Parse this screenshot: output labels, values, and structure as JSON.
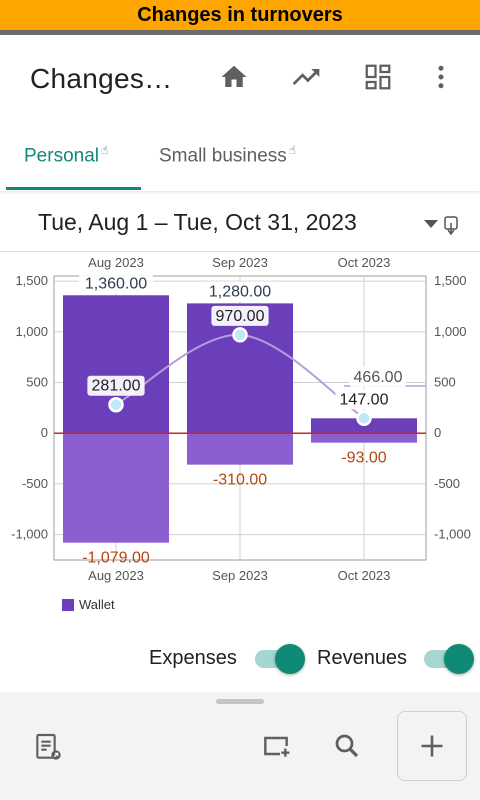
{
  "banner": {
    "title": "Changes in turnovers"
  },
  "appbar": {
    "title": "Changes…",
    "icons": [
      "home-icon",
      "trending-up-icon",
      "dashboard-grid-icon",
      "more-vert-icon"
    ]
  },
  "tabs": [
    {
      "label": "Personal",
      "selected": true
    },
    {
      "label": "Small business",
      "selected": false
    }
  ],
  "date_range": {
    "label": "Tue, Aug 1 – Tue, Oct 31, 2023"
  },
  "chart_data": {
    "type": "bar",
    "categories": [
      "Aug 2023",
      "Sep 2023",
      "Oct 2023"
    ],
    "series": [
      {
        "name": "Wallet",
        "kind": "revenue-bar",
        "values": [
          1360,
          1280,
          147
        ],
        "labels": [
          "1,360.00",
          "1,280.00",
          "147.00"
        ],
        "color": "#6a3fb9"
      },
      {
        "name": "Wallet",
        "kind": "expense-bar",
        "values": [
          -1079,
          -310,
          -93
        ],
        "labels": [
          "-1,079.00",
          "-310.00",
          "-93.00"
        ],
        "color": "#8b5fcf"
      },
      {
        "kind": "balance-line",
        "values": [
          281,
          970,
          147
        ],
        "labels": [
          "281.00",
          "970.00",
          "147.00"
        ],
        "color": "#b39ddb"
      },
      {
        "kind": "reference-line",
        "values": [
          466
        ],
        "labels": [
          "466.00"
        ],
        "color": "#b39ddb"
      }
    ],
    "ylim": [
      -1300,
      1600
    ],
    "yticks": [
      1500,
      1000,
      500,
      0,
      -500,
      -1000
    ],
    "ytick_labels": [
      "1,500",
      "1,000",
      "500",
      "0",
      "-500",
      "-1,000"
    ],
    "grid": true,
    "legend": {
      "position": "bottom-left",
      "entries": [
        "Wallet"
      ]
    },
    "zero_line_color": "#c62828",
    "expense_label_color": "#b3470f",
    "revenue_label_color": "#2c3e50"
  },
  "toggles": [
    {
      "label": "Expenses",
      "on": true
    },
    {
      "label": "Revenues",
      "on": true
    }
  ],
  "bottom_bar": {
    "icons": [
      "report-icon",
      "add-window-icon",
      "search-icon",
      "add-icon"
    ]
  },
  "colors": {
    "accent": "#0f8a79",
    "banner": "#ffa500",
    "bar": "#6a3fb9"
  }
}
